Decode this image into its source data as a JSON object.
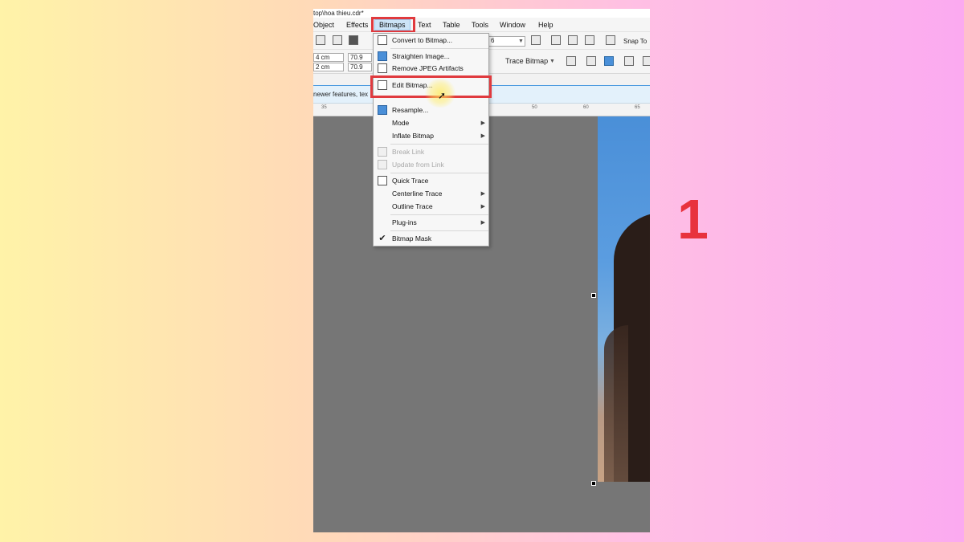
{
  "step_number": "1",
  "window": {
    "title": "top\\hoa thieu.cdr*"
  },
  "menubar": {
    "items": [
      {
        "label": "Object",
        "x": 0
      },
      {
        "label": "Effects"
      },
      {
        "label": "Bitmaps",
        "active": true
      },
      {
        "label": "Text"
      },
      {
        "label": "Table"
      },
      {
        "label": "Tools"
      },
      {
        "label": "Window"
      },
      {
        "label": "Help"
      }
    ]
  },
  "toolbar": {
    "snap_label": "Snap To",
    "zoom_value": "6",
    "trace_bitmap_label": "Trace Bitmap"
  },
  "property_bar": {
    "width_value": "4 cm",
    "height_value": "2 cm",
    "scale_x": "70.9",
    "scale_y": "70.9"
  },
  "infobar": {
    "text": "newer features, tex"
  },
  "ruler": {
    "ticks": [
      "35",
      "50",
      "60",
      "65"
    ]
  },
  "bitmaps_menu": {
    "items": [
      {
        "label": "Convert to Bitmap...",
        "icon": "convert-bitmap-icon",
        "enabled": true
      },
      {
        "label": "Straighten Image...",
        "icon": "straighten-icon",
        "enabled": true
      },
      {
        "label": "Remove JPEG Artifacts",
        "icon": "jpeg-artifacts-icon",
        "enabled": true
      },
      {
        "label": "Edit Bitmap...",
        "icon": "edit-bitmap-icon",
        "enabled": true,
        "highlighted": true
      },
      {
        "label": "Resample...",
        "icon": "resample-icon",
        "enabled": true
      },
      {
        "label": "Mode",
        "submenu": true,
        "enabled": true
      },
      {
        "label": "Inflate Bitmap",
        "submenu": true,
        "enabled": true
      },
      {
        "label": "Break Link",
        "icon": "break-link-icon",
        "enabled": false
      },
      {
        "label": "Update from Link",
        "icon": "update-link-icon",
        "enabled": false
      },
      {
        "label": "Quick Trace",
        "icon": "quick-trace-icon",
        "enabled": true
      },
      {
        "label": "Centerline Trace",
        "submenu": true,
        "enabled": true
      },
      {
        "label": "Outline Trace",
        "submenu": true,
        "enabled": true
      },
      {
        "label": "Plug-ins",
        "submenu": true,
        "enabled": true
      },
      {
        "label": "Bitmap Mask",
        "icon": "checkmark-icon",
        "checked": true,
        "enabled": true
      }
    ]
  },
  "colors": {
    "highlight_red": "#e03a3e",
    "step_red": "#e8323d",
    "canvas_grey": "#767676",
    "menu_active_blue": "#cce4f7"
  }
}
